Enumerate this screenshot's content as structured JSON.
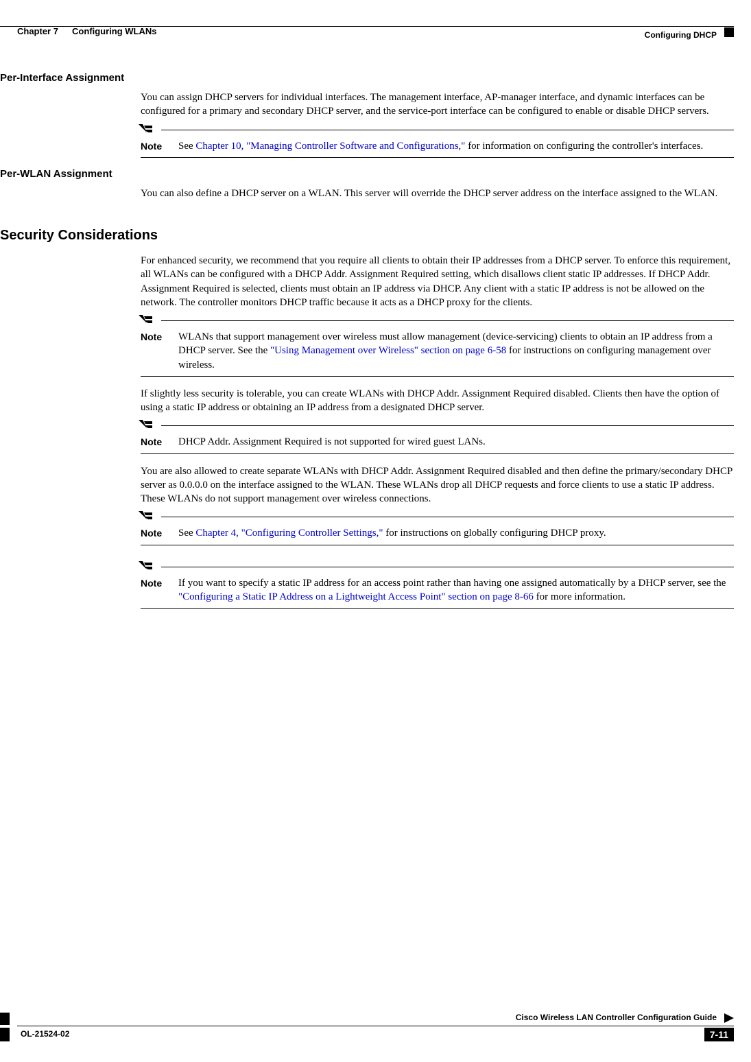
{
  "header": {
    "chapter_label": "Chapter 7",
    "chapter_title": "Configuring WLANs",
    "section_title": "Configuring DHCP"
  },
  "sections": {
    "per_interface": {
      "heading": "Per-Interface Assignment",
      "p1": "You can assign DHCP servers for individual interfaces. The management interface, AP-manager interface, and dynamic interfaces can be configured for a primary and secondary DHCP server, and the service-port interface can be configured to enable or disable DHCP servers.",
      "note1_label": "Note",
      "note1_pre": "See ",
      "note1_link": "Chapter 10, \"Managing Controller Software and Configurations,\"",
      "note1_post": " for information on configuring the controller's interfaces."
    },
    "per_wlan": {
      "heading": "Per-WLAN Assignment",
      "p1": "You can also define a DHCP server on a WLAN. This server will override the DHCP server address on the interface assigned to the WLAN."
    },
    "security": {
      "heading": "Security Considerations",
      "p1": "For enhanced security, we recommend that you require all clients to obtain their IP addresses from a DHCP server. To enforce this requirement, all WLANs can be configured with a DHCP Addr. Assignment Required setting, which disallows client static IP addresses. If DHCP Addr. Assignment Required is selected, clients must obtain an IP address via DHCP. Any client with a static IP address is not be allowed on the network. The controller monitors DHCP traffic because it acts as a DHCP proxy for the clients.",
      "note1_label": "Note",
      "note1_pre": "WLANs that support management over wireless must allow management (device-servicing) clients to obtain an IP address from a DHCP server. See the ",
      "note1_link": "\"Using Management over Wireless\" section on page 6-58",
      "note1_post": " for instructions on configuring management over wireless.",
      "p2": "If slightly less security is tolerable, you can create WLANs with DHCP Addr. Assignment Required disabled. Clients then have the option of using a static IP address or obtaining an IP address from a designated DHCP server.",
      "note2_label": "Note",
      "note2_text": "DHCP Addr. Assignment Required is not supported for wired guest LANs.",
      "p3": "You are also allowed to create separate WLANs with DHCP Addr. Assignment Required disabled and then define the primary/secondary DHCP server as 0.0.0.0 on the interface assigned to the WLAN. These WLANs drop all DHCP requests and force clients to use a static IP address. These WLANs do not support management over wireless connections.",
      "note3_label": "Note",
      "note3_pre": "See ",
      "note3_link": "Chapter 4, \"Configuring Controller Settings,\"",
      "note3_post": " for instructions on globally configuring DHCP proxy.",
      "note4_label": "Note",
      "note4_pre": "If you want to specify a static IP address for an access point rather than having one assigned automatically by a DHCP server, see the ",
      "note4_link": "\"Configuring a Static IP Address on a Lightweight Access Point\" section on page 8-66",
      "note4_post": " for more information."
    }
  },
  "footer": {
    "doc_title": "Cisco Wireless LAN Controller Configuration Guide",
    "doc_id": "OL-21524-02",
    "page_num": "7-11"
  }
}
